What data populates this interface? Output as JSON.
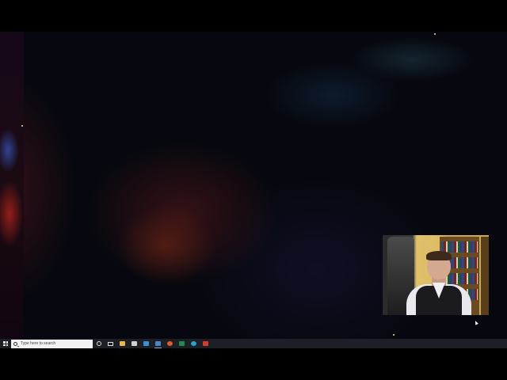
{
  "taskbar": {
    "search": {
      "placeholder": "Type here to search"
    },
    "pinned_apps": [
      {
        "name": "cortana-icon"
      },
      {
        "name": "task-view-icon"
      },
      {
        "name": "file-explorer-icon",
        "color": "#e8b84a"
      },
      {
        "name": "camera-icon",
        "color": "#d0d0d0"
      },
      {
        "name": "mail-icon",
        "color": "#3b8fd8"
      },
      {
        "name": "zoom-icon",
        "color": "#4a86c8"
      },
      {
        "name": "firefox-icon",
        "color": "#e05a2a"
      },
      {
        "name": "excel-icon",
        "color": "#1f8a4c"
      },
      {
        "name": "edge-icon",
        "color": "#2aa3c9"
      },
      {
        "name": "acrobat-icon",
        "color": "#d83a2a"
      }
    ]
  },
  "colors": {
    "taskbar": "#1d1f26",
    "search_box": "#f2f2f2",
    "active_indicator": "#7fb2e5"
  }
}
